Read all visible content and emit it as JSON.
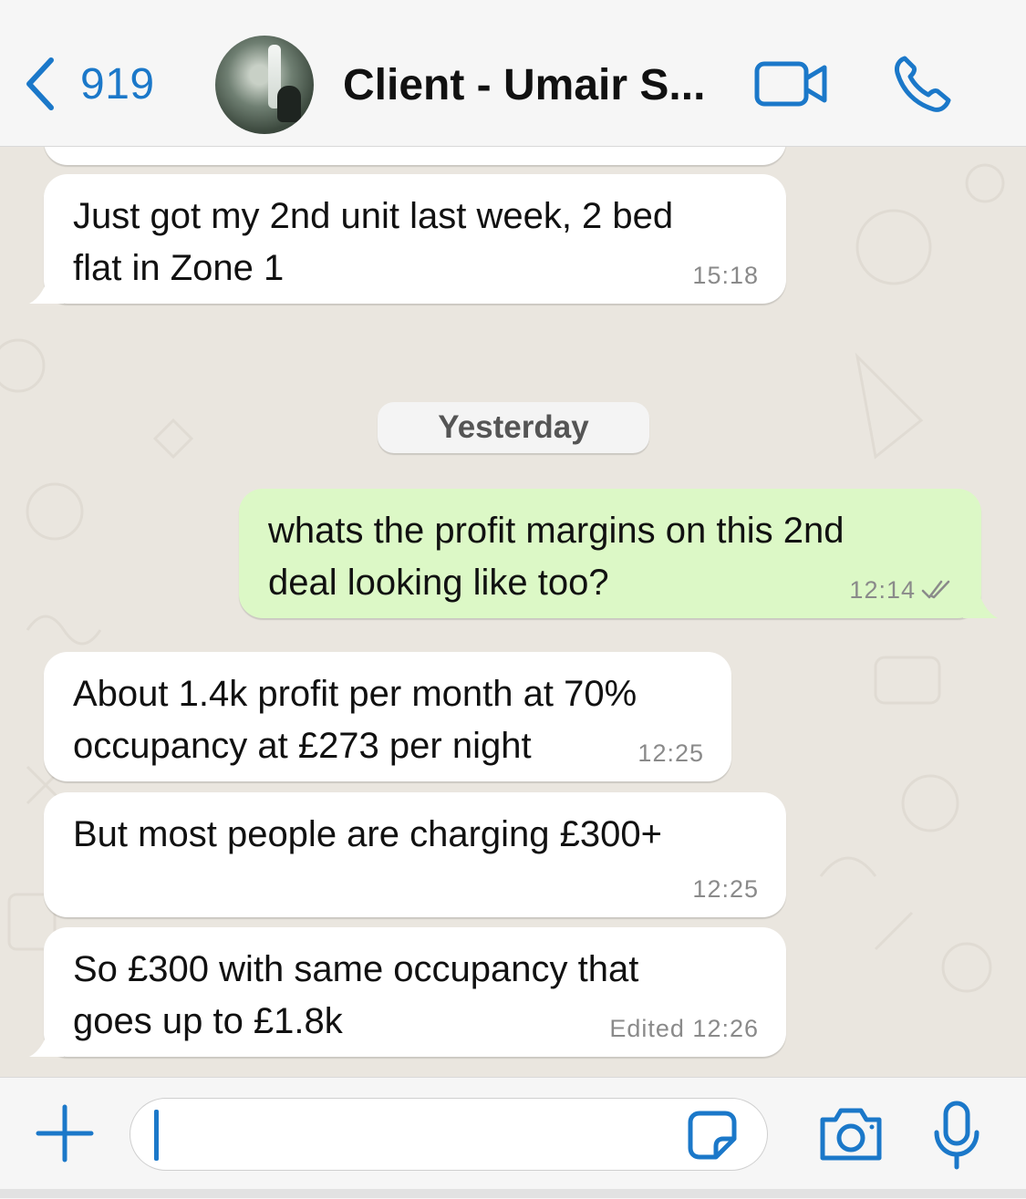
{
  "header": {
    "back_count": "919",
    "contact_name": "Client - Umair S...",
    "accent": "#1b78c9"
  },
  "chat": {
    "date_separator": "Yesterday",
    "messages": [
      {
        "direction": "incoming",
        "lines": [
          "Just got my 2nd unit last week, 2 bed",
          "flat in Zone 1"
        ],
        "time": "15:18"
      },
      {
        "direction": "outgoing",
        "lines": [
          "whats the profit margins on this 2nd",
          "deal looking like too?"
        ],
        "time": "12:14",
        "status": "delivered-double-tick"
      },
      {
        "direction": "incoming",
        "lines": [
          "About 1.4k profit per month at 70%",
          "occupancy at £273 per night"
        ],
        "time": "12:25"
      },
      {
        "direction": "incoming",
        "lines": [
          "But most people are charging £300+"
        ],
        "time": "12:25"
      },
      {
        "direction": "incoming",
        "lines": [
          "So £300 with same occupancy that",
          "goes up to £1.8k"
        ],
        "time": "Edited 12:26"
      }
    ],
    "outgoing_bubble_color": "#dcf8c6",
    "incoming_bubble_color": "#ffffff"
  },
  "composer": {
    "message_value": ""
  }
}
